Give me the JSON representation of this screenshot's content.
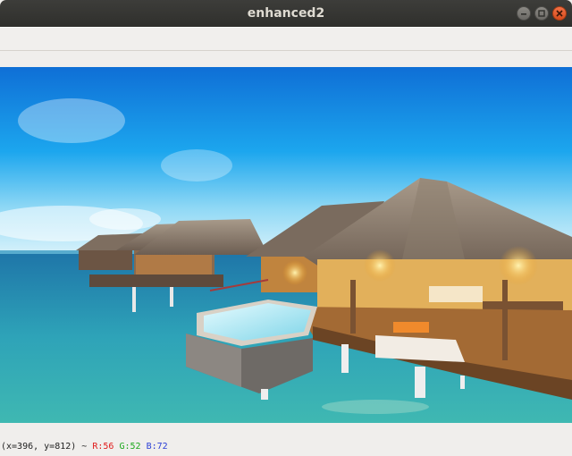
{
  "window": {
    "title": "enhanced2",
    "controls": [
      "minimize-icon",
      "maximize-icon",
      "close-icon"
    ],
    "accent": "#e95420"
  },
  "image": {
    "description_icon": "image-icon"
  },
  "status": {
    "coords": "(x=396, y=812) ~ ",
    "r": "R:56",
    "g": "G:52",
    "b": "B:72"
  }
}
